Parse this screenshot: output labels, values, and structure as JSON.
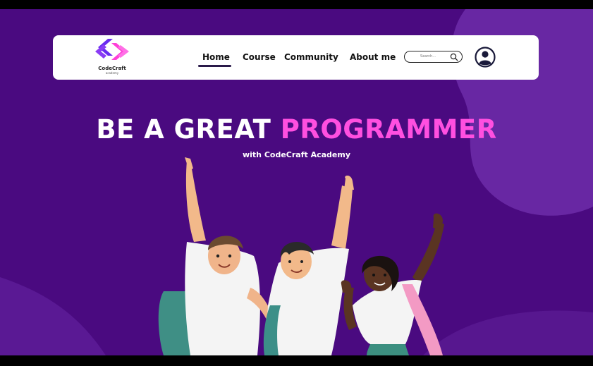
{
  "brand": {
    "name": "CodeCraft",
    "tagline": "academy"
  },
  "nav": {
    "links": [
      {
        "label": "Home",
        "active": true
      },
      {
        "label": "Course"
      },
      {
        "label": "Community"
      },
      {
        "label": "About me"
      }
    ]
  },
  "search": {
    "placeholder": "Search..."
  },
  "hero": {
    "title_part1": "BE A GREAT",
    "title_part2": "PROGRAMMER",
    "subtitle": "with CodeCraft Academy"
  },
  "colors": {
    "background": "#4a0a80",
    "accent": "#ff4fe0",
    "logo_blue": "#6a2cf0",
    "logo_pink": "#ff3fd8"
  }
}
